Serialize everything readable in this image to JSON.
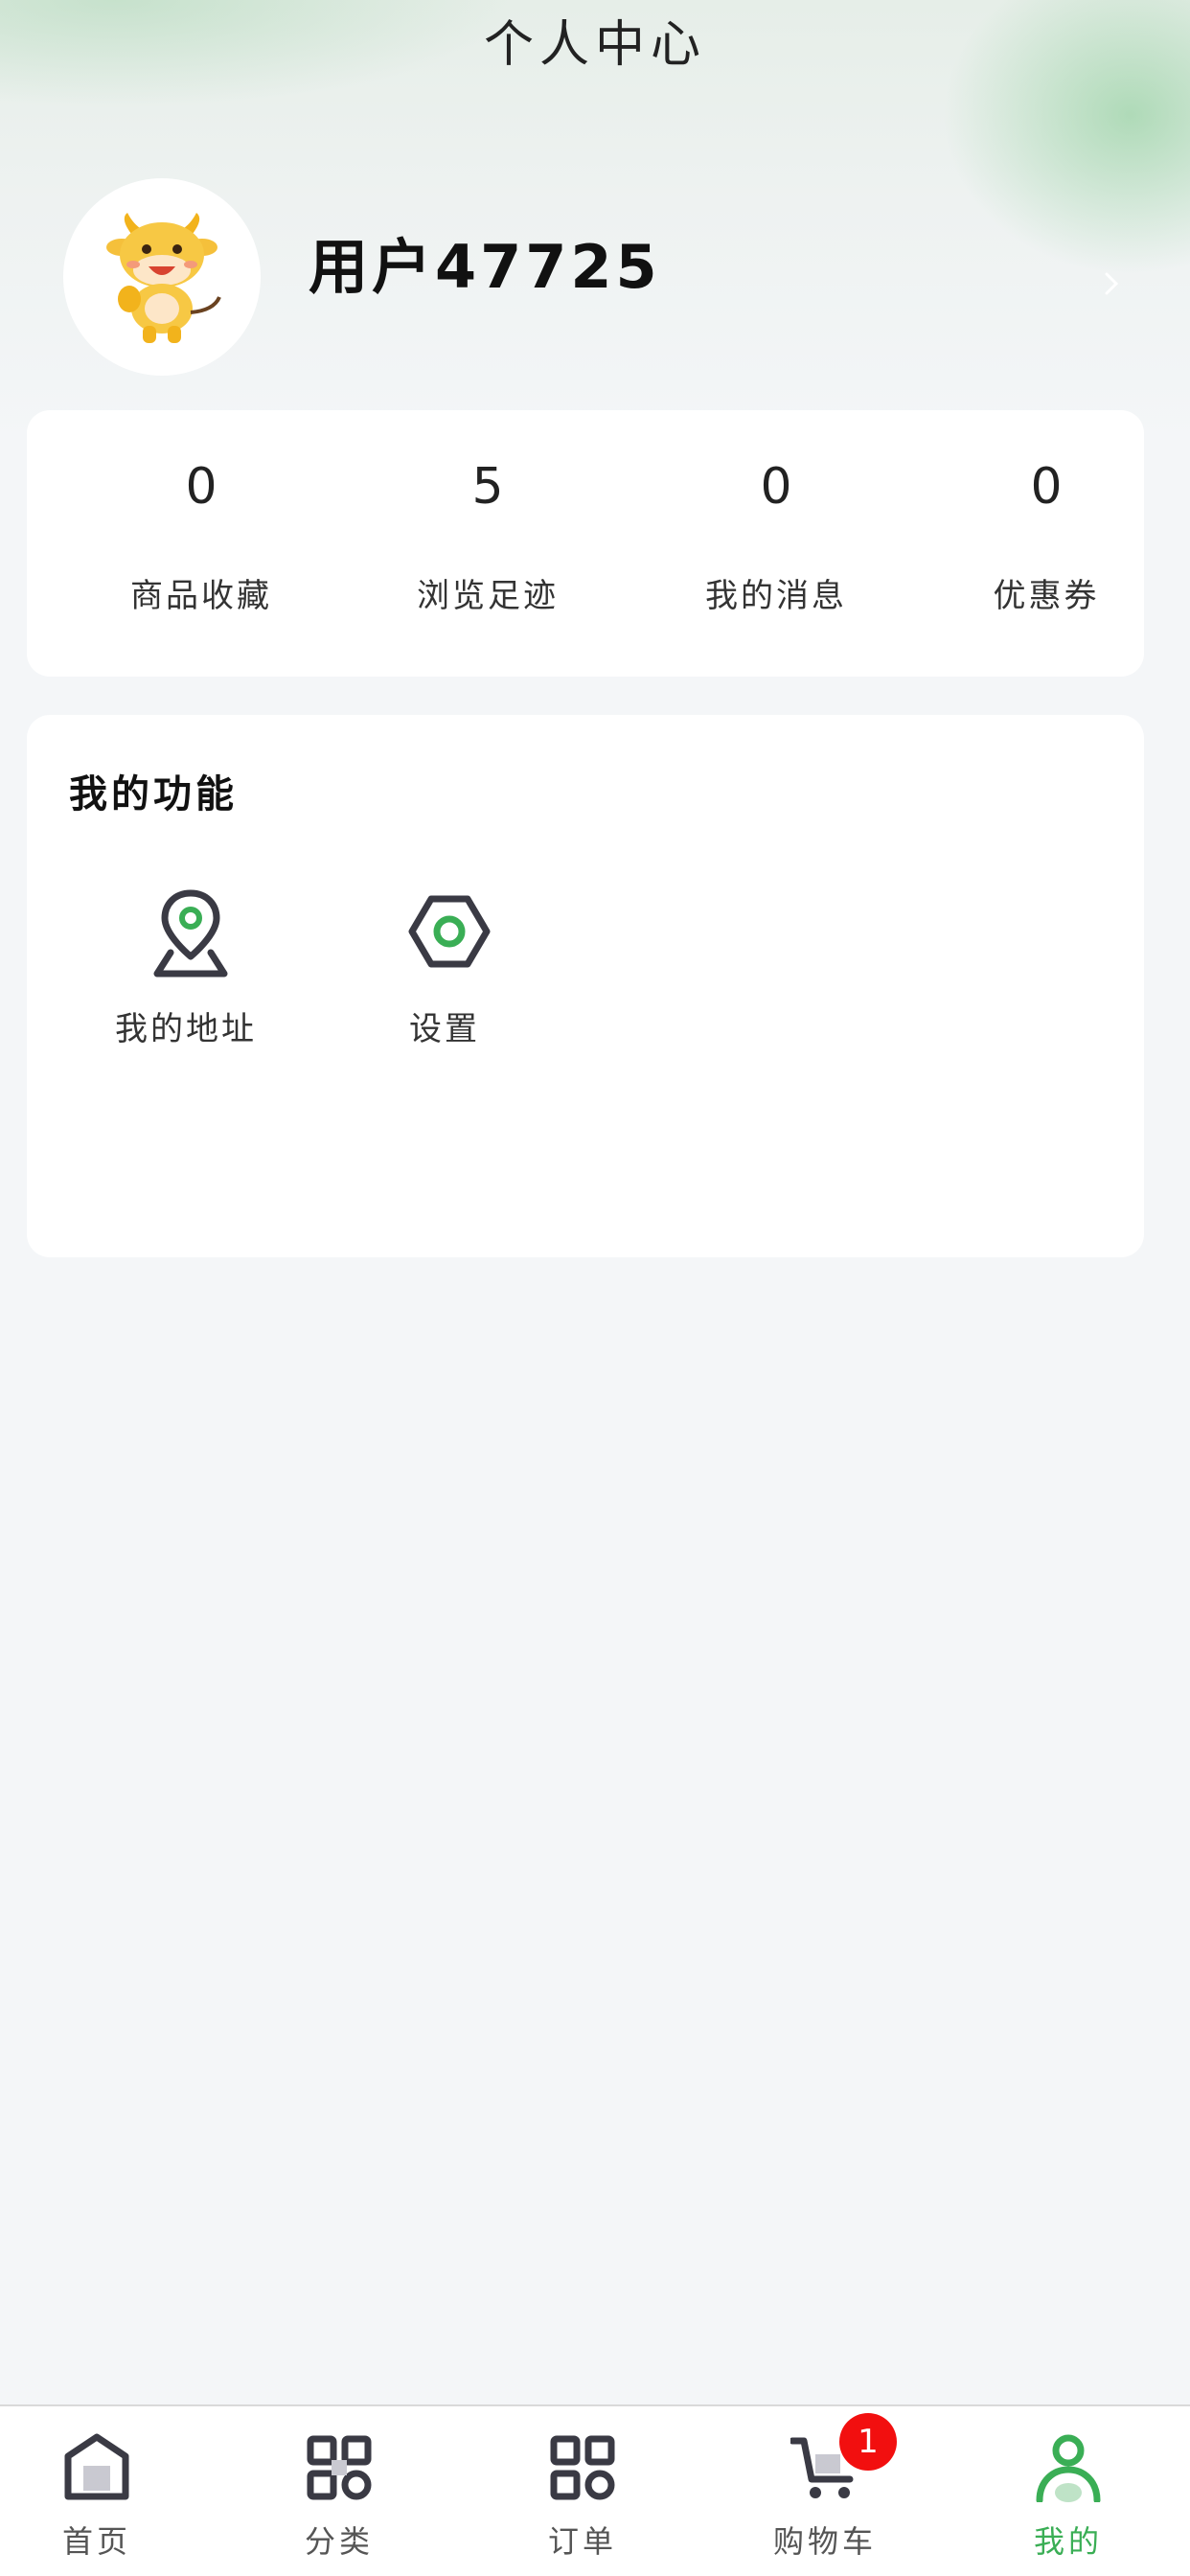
{
  "header": {
    "title": "个人中心"
  },
  "profile": {
    "username": "用户47725",
    "avatar_icon": "cow-mascot-icon",
    "chevron_icon": "chevron-right-icon"
  },
  "stats": [
    {
      "value": "0",
      "label": "商品收藏"
    },
    {
      "value": "5",
      "label": "浏览足迹"
    },
    {
      "value": "0",
      "label": "我的消息"
    },
    {
      "value": "0",
      "label": "优惠券"
    }
  ],
  "functions": {
    "title": "我的功能",
    "items": [
      {
        "label": "我的地址",
        "icon": "location-pin-icon"
      },
      {
        "label": "设置",
        "icon": "settings-hexagon-icon"
      }
    ]
  },
  "tabbar": {
    "items": [
      {
        "label": "首页",
        "icon": "home-icon"
      },
      {
        "label": "分类",
        "icon": "category-grid-icon"
      },
      {
        "label": "订单",
        "icon": "order-grid-icon"
      },
      {
        "label": "购物车",
        "icon": "cart-icon"
      },
      {
        "label": "我的",
        "icon": "user-icon"
      }
    ],
    "active_index": 4,
    "cart_badge": "1"
  },
  "colors": {
    "accent": "#3aae55",
    "badge": "#f20f0f",
    "icon_dark": "#3a3a44"
  }
}
